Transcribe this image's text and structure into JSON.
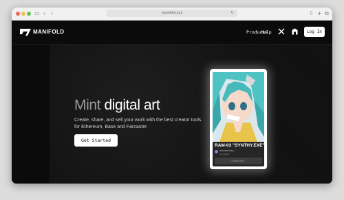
{
  "browser": {
    "url": "manifold.xyz",
    "icons": [
      "sidebar-icon",
      "back-icon",
      "forward-icon",
      "reload-icon",
      "share-icon",
      "new-tab-icon",
      "tabs-icon"
    ]
  },
  "nav": {
    "logo_text": "MANIFOLD",
    "links": [
      "Products",
      "Help"
    ],
    "login_label": "Log In"
  },
  "hero": {
    "title_part1": "Mint",
    "title_part2": "digital art",
    "subtitle": "Create, share, and sell your work with the best creator tools for Ethereum, Base and Farcaster",
    "cta_label": "Get Started"
  },
  "featured": {
    "title": "RAM-03 \"SYNTHY.EXE\"",
    "creator": "aboutcarhas",
    "meta": "● Available",
    "button_label": "Loading Mint..."
  },
  "colors": {
    "background": "#0b0b0b",
    "button_bg": "#ffffff",
    "title_muted": "#9a9a9a",
    "hair": "#4fc3c3"
  }
}
